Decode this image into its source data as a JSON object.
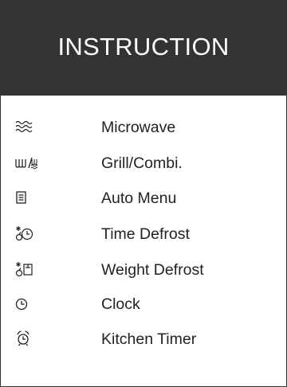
{
  "header": {
    "title": "INSTRUCTION"
  },
  "items": [
    {
      "icon": "microwave-waves-icon",
      "label": "Microwave"
    },
    {
      "icon": "grill-combi-icon",
      "label": "Grill/Combi."
    },
    {
      "icon": "auto-menu-icon",
      "label": "Auto Menu"
    },
    {
      "icon": "time-defrost-icon",
      "label": "Time Defrost"
    },
    {
      "icon": "weight-defrost-icon",
      "label": "Weight Defrost"
    },
    {
      "icon": "clock-icon",
      "label": "Clock"
    },
    {
      "icon": "kitchen-timer-icon",
      "label": "Kitchen Timer"
    }
  ]
}
